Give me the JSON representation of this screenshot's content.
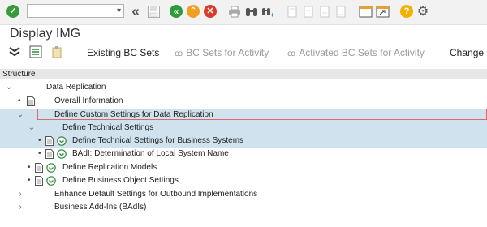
{
  "toolbar": {
    "command_field_value": ""
  },
  "title": "Display IMG",
  "app_toolbar": {
    "existing_bc_sets": "Existing BC Sets",
    "bc_sets_for_activity": "BC Sets for Activity",
    "activated_bc_sets_for_activity": "Activated BC Sets for Activity",
    "change_log": "Change L"
  },
  "structure": {
    "header": "Structure",
    "rows": [
      {
        "label": "Data Replication",
        "state": "expanded",
        "icons": []
      },
      {
        "label": "Overall Information",
        "state": "leaf",
        "icons": [
          "doc"
        ]
      },
      {
        "label": "Define Custom Settings for Data Replication",
        "state": "expanded",
        "icons": [],
        "selected": true
      },
      {
        "label": "Define Technical Settings",
        "state": "expanded",
        "icons": [],
        "selected": true
      },
      {
        "label": "Define Technical Settings for Business Systems",
        "state": "leaf",
        "icons": [
          "doc",
          "execute"
        ],
        "selected": true
      },
      {
        "label": "BAdI: Determination of Local System Name",
        "state": "leaf",
        "icons": [
          "doc",
          "execute"
        ]
      },
      {
        "label": "Define Replication Models",
        "state": "leaf",
        "icons": [
          "doc",
          "execute"
        ]
      },
      {
        "label": "Define Business Object Settings",
        "state": "leaf",
        "icons": [
          "doc",
          "execute"
        ]
      },
      {
        "label": "Enhance Default Settings for Outbound Implementations",
        "state": "collapsed",
        "icons": []
      },
      {
        "label": "Business Add-Ins (BAdIs)",
        "state": "collapsed",
        "icons": []
      }
    ]
  },
  "colors": {
    "enter_green": "#3a9a3a",
    "back_green": "#2f9a3a",
    "exit_orange": "#f0a020",
    "cancel_red": "#d93a2a",
    "help_yellow": "#f3b000",
    "selection_blue": "#cfe2ee",
    "execute_green": "#2e8b3e"
  }
}
